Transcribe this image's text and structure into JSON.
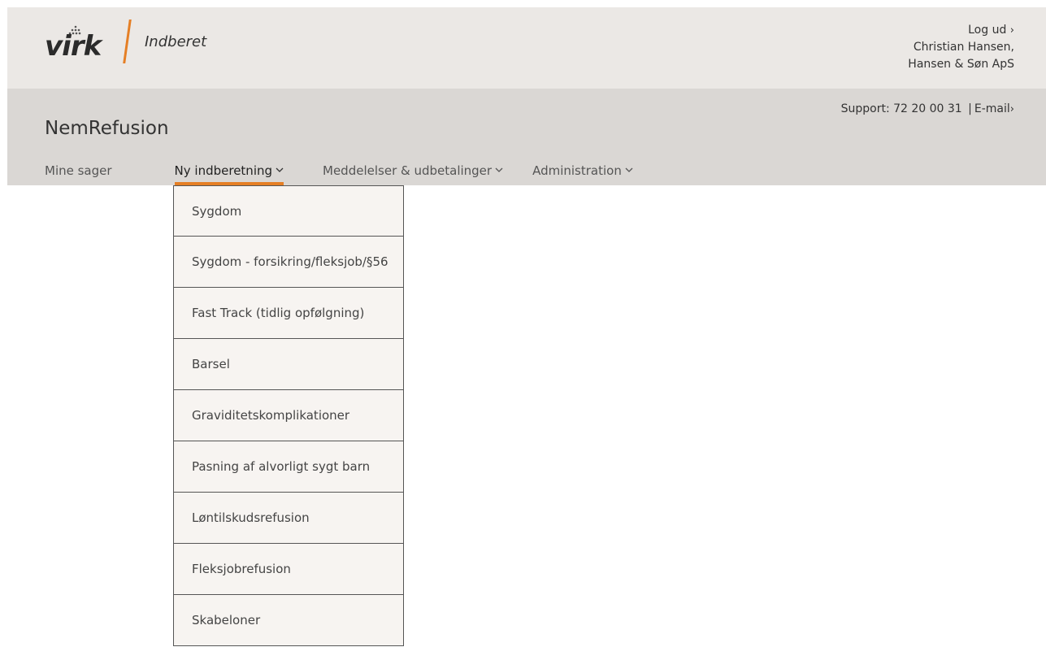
{
  "header": {
    "logo_text": "virk",
    "logo_sub": "Indberet",
    "logout": "Log ud",
    "user_name": "Christian Hansen,",
    "company": "Hansen & Søn ApS"
  },
  "band": {
    "support_label": "Support: 72 20 00 31",
    "support_sep": "|",
    "email_label": "E-mail",
    "app_title": "NemRefusion"
  },
  "nav": {
    "items": [
      {
        "label": "Mine sager"
      },
      {
        "label": "Ny indberetning"
      },
      {
        "label": "Meddelelser & udbetalinger"
      },
      {
        "label": "Administration"
      }
    ]
  },
  "dropdown": {
    "items": [
      {
        "label": "Sygdom"
      },
      {
        "label": "Sygdom - forsikring/fleksjob/§56"
      },
      {
        "label": "Fast Track (tidlig opfølgning)"
      },
      {
        "label": "Barsel"
      },
      {
        "label": "Graviditetskomplikationer"
      },
      {
        "label": "Pasning af alvorligt sygt barn"
      },
      {
        "label": "Løntilskudsrefusion"
      },
      {
        "label": "Fleksjobrefusion"
      },
      {
        "label": "Skabeloner"
      }
    ]
  },
  "colors": {
    "accent": "#e57f25",
    "topbar_bg": "#ebe8e5",
    "band_bg": "#dad7d4",
    "dropdown_bg": "#f7f4f1"
  }
}
